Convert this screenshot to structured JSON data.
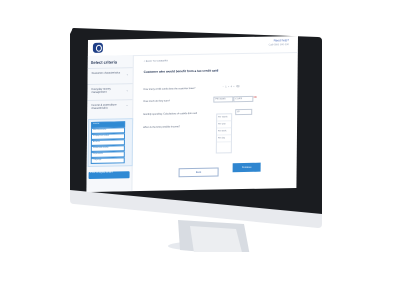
{
  "header": {
    "help_line1": "Need help?",
    "help_line2": "Call 0800 000 000"
  },
  "sidebar": {
    "title": "Select criteria",
    "items": [
      {
        "label": "Customer characteristics"
      },
      {
        "label": "Everyday money management"
      },
      {
        "label": "Income & expenditure characteristics"
      }
    ],
    "subitems": [
      "Income",
      "Monthly income",
      "Employment status",
      "Benefits",
      "Household income",
      "Dependants",
      "Outgoings"
    ],
    "action_label": "Show all eligible lenders"
  },
  "main": {
    "back_link": "< BACK TO SUMMARY",
    "question": "Customer who would benefit from a tax credit card",
    "fields": [
      {
        "label": "How many credit cards does the customer have?"
      },
      {
        "label": "How much do they earn?",
        "select": "Per month",
        "value": "£1,800"
      },
      {
        "label": "Monthly spending: Calculations of outside this card",
        "value": "£0"
      },
      {
        "label": "When is the best possible income?"
      }
    ],
    "dropdown_options": [
      "Per month",
      "Per year",
      "Per week",
      "Per day"
    ],
    "back_button": "Back",
    "continue_button": "Continue"
  }
}
